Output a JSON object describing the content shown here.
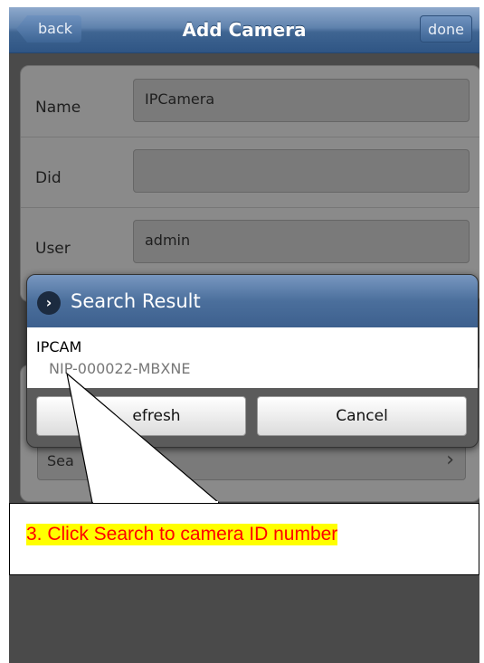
{
  "header": {
    "back_label": "back",
    "title": "Add Camera",
    "done_label": "done"
  },
  "form": {
    "fields": [
      {
        "label": "Name",
        "value": "IPCamera"
      },
      {
        "label": "Did",
        "value": ""
      },
      {
        "label": "User",
        "value": "admin"
      }
    ],
    "search_label": "Sea"
  },
  "dialog": {
    "title": "Search Result",
    "results": [
      {
        "name": "IPCAM",
        "id": "NIP-000022-MBXNE"
      }
    ],
    "refresh_label": "efresh",
    "cancel_label": "Cancel"
  },
  "annotation": {
    "text": "3. Click Search to camera ID number"
  },
  "colors": {
    "header_blue": "#3f6592",
    "callout_text": "#ff0000",
    "callout_highlight": "#ffff00"
  }
}
